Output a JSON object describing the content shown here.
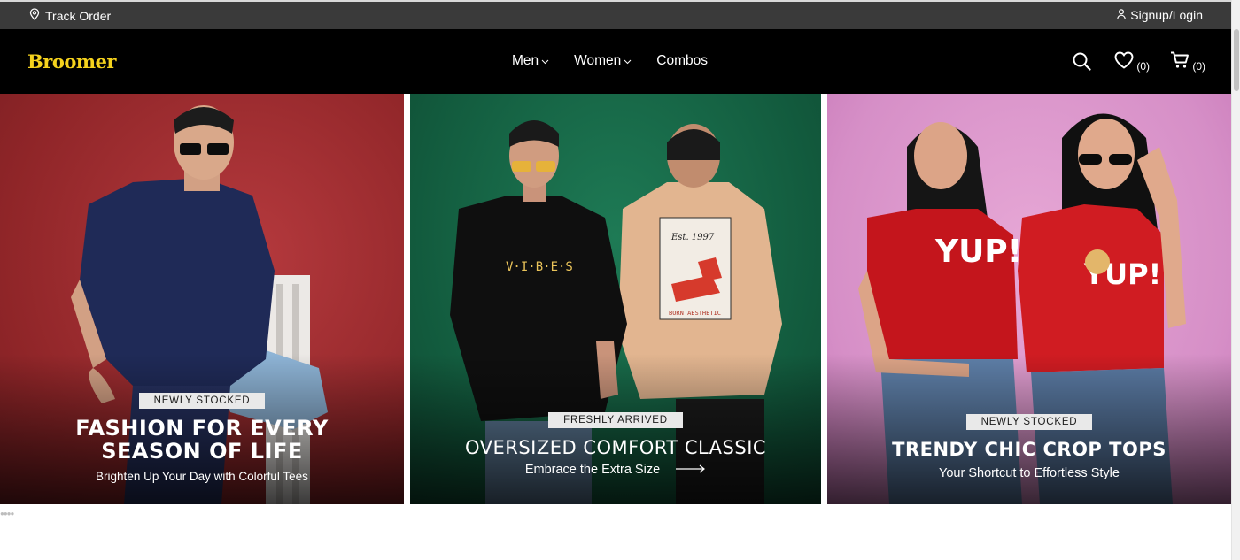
{
  "topbar": {
    "track_order": "Track Order",
    "signup_login": "Signup/Login"
  },
  "brand": {
    "logo": "Broomer",
    "logo_color": "#f5d21d"
  },
  "nav": {
    "items": [
      "Men",
      "Women",
      "Combos"
    ]
  },
  "actions": {
    "wishlist_count": "(0)",
    "cart_count": "(0)"
  },
  "banners": [
    {
      "badge": "NEWLY STOCKED",
      "headline_line1": "FASHION FOR EVERY",
      "headline_line2": "SEASON OF LIFE",
      "subtitle": "Brighten Up Your Day with Colorful Tees"
    },
    {
      "badge": "FRESHLY ARRIVED",
      "headline": "OVERSIZED COMFORT CLASSIC",
      "subtitle": "Embrace the Extra Size",
      "shirt_text": "V·I·B·E·S",
      "back_print": "BORN AESTHETIC",
      "back_year": "Est. 1997"
    },
    {
      "badge": "NEWLY STOCKED",
      "headline": "TRENDY CHIC CROP TOPS",
      "subtitle": "Your Shortcut to Effortless Style",
      "shirt_text_left": "YUP!",
      "shirt_text_right": "YUP!"
    }
  ],
  "colors": {
    "banner1_bg": "#9c2a2e",
    "banner2_bg": "#14613f",
    "banner3_bg": "#dc95c9",
    "topbar": "#3a3a3a",
    "navbar": "#000000"
  }
}
